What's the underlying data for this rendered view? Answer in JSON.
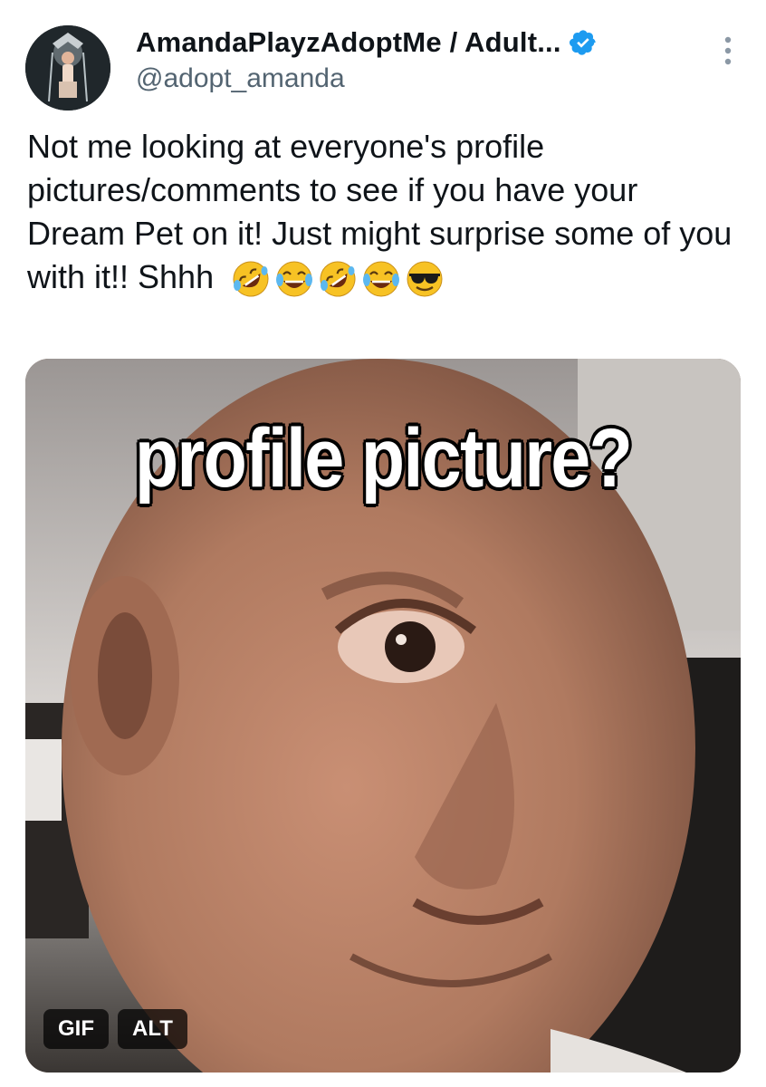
{
  "author": {
    "display_name": "AmandaPlayzAdoptMe / Adult...",
    "handle": "@adopt_amanda",
    "verified_icon": "verified-badge-icon",
    "avatar_icon": "avatar-image"
  },
  "tweet": {
    "text": "Not me looking at everyone's profile pictures/comments to see if you have your Dream Pet on it! Just might surprise some of you with it!! Shhh",
    "emojis": [
      "rolling-on-floor-laughing",
      "tears-of-joy",
      "rolling-on-floor-laughing",
      "tears-of-joy",
      "sunglasses-face"
    ]
  },
  "media": {
    "caption": "profile picture?",
    "gif_label": "GIF",
    "alt_label": "ALT"
  },
  "colors": {
    "text": "#0f1419",
    "secondary": "#536471",
    "verified": "#1d9bf0"
  }
}
